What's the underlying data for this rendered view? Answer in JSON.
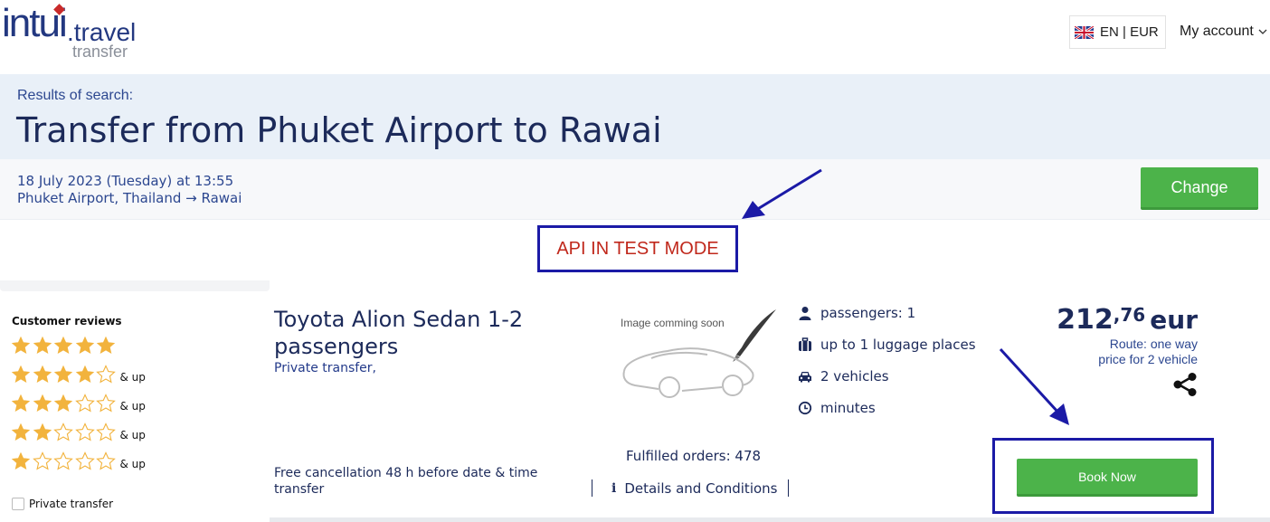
{
  "brand": {
    "logo_main": "intui",
    "logo_suffix": ".travel",
    "logo_sub": "transfer"
  },
  "header": {
    "language_currency": "EN | EUR",
    "flag_icon": "uk-flag-icon",
    "account_label": "My account"
  },
  "search": {
    "results_label": "Results of search:",
    "title": "Transfer from Phuket Airport to Rawai",
    "date": "18 July 2023 (Tuesday) at 13:55",
    "route": "Phuket Airport, Thailand → Rawai",
    "change_label": "Change"
  },
  "notice": {
    "test_mode": "API IN TEST MODE"
  },
  "filters": {
    "reviews_title": "Customer reviews",
    "and_up": "& up",
    "ratings": [
      5,
      4,
      3,
      2,
      1
    ],
    "private_transfer_label": "Private transfer",
    "private_transfer_checked": false
  },
  "result": {
    "vehicle_name": "Toyota Alion Sedan 1-2 passengers",
    "transfer_type": "Private transfer,",
    "image_caption": "Image comming soon",
    "features": {
      "passengers": "passengers: 1",
      "luggage": "up to 1 luggage places",
      "vehicles": "2 vehicles",
      "duration": "minutes"
    },
    "price_whole": "212",
    "price_cents": ",76",
    "currency": "eur",
    "route_note": "Route: one way",
    "price_note": "price for 2 vehicle",
    "cancellation": "Free cancellation 48 h before date & time transfer",
    "orders": "Fulfilled orders: 478",
    "details_label": "Details and Conditions",
    "book_label": "Book Now"
  },
  "colors": {
    "primary_navy": "#1c2a5a",
    "accent_green": "#4cb34a",
    "banner_bg": "#e9f0f8",
    "highlight_blue": "#1b1aa6",
    "test_mode_red": "#c0281c",
    "star_gold": "#f2b33d"
  }
}
